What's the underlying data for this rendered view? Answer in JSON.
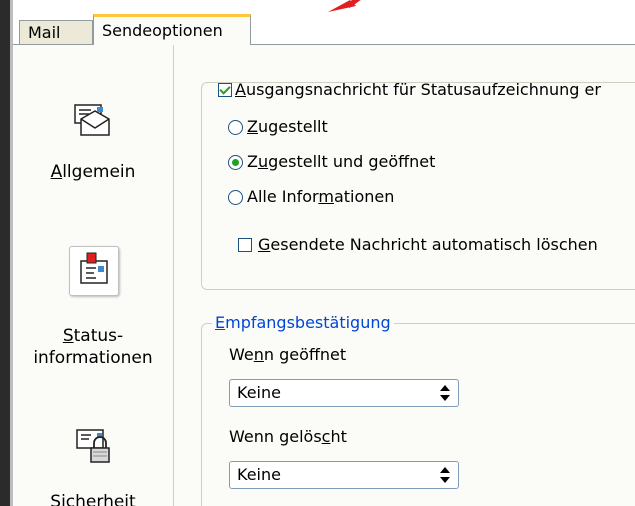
{
  "tabs": [
    {
      "label": "Mail"
    },
    {
      "label": "Sendeoptionen",
      "active": true
    }
  ],
  "nav": {
    "general": {
      "pre": "",
      "ul": "A",
      "post": "llgemein"
    },
    "status": {
      "pre": "",
      "ul": "S",
      "post": "tatus-",
      "line2": "informationen"
    },
    "security": {
      "label": "Sicherheit"
    }
  },
  "status_tracking": {
    "checkbox": {
      "pre": "",
      "ul": "A",
      "post": "usgangsnachricht für Statusaufzeichnung er",
      "checked": true
    },
    "options": [
      {
        "pre": "",
        "ul": "Z",
        "post": "ugestellt",
        "selected": false
      },
      {
        "pre": "Z",
        "ul": "u",
        "post": "gestellt und geöffnet",
        "selected": true
      },
      {
        "pre": "Alle Infor",
        "ul": "m",
        "post": "ationen",
        "selected": false
      }
    ],
    "auto_delete": {
      "pre": "",
      "ul": "G",
      "post": "esendete Nachricht automatisch löschen",
      "checked": false
    }
  },
  "receipt": {
    "legend": {
      "pre": "",
      "ul": "E",
      "post": "mpfangsbestätigung"
    },
    "opened": {
      "pre": "We",
      "ul": "n",
      "post": "n geöffnet",
      "value": "Keine"
    },
    "deleted": {
      "pre": "Wenn gelös",
      "ul": "c",
      "post": "ht",
      "value": "Keine"
    }
  },
  "colors": {
    "legend": "#0046d5",
    "check": "#21a121",
    "arrow": "#e02020",
    "tab_highlight": "#ffc83c"
  }
}
